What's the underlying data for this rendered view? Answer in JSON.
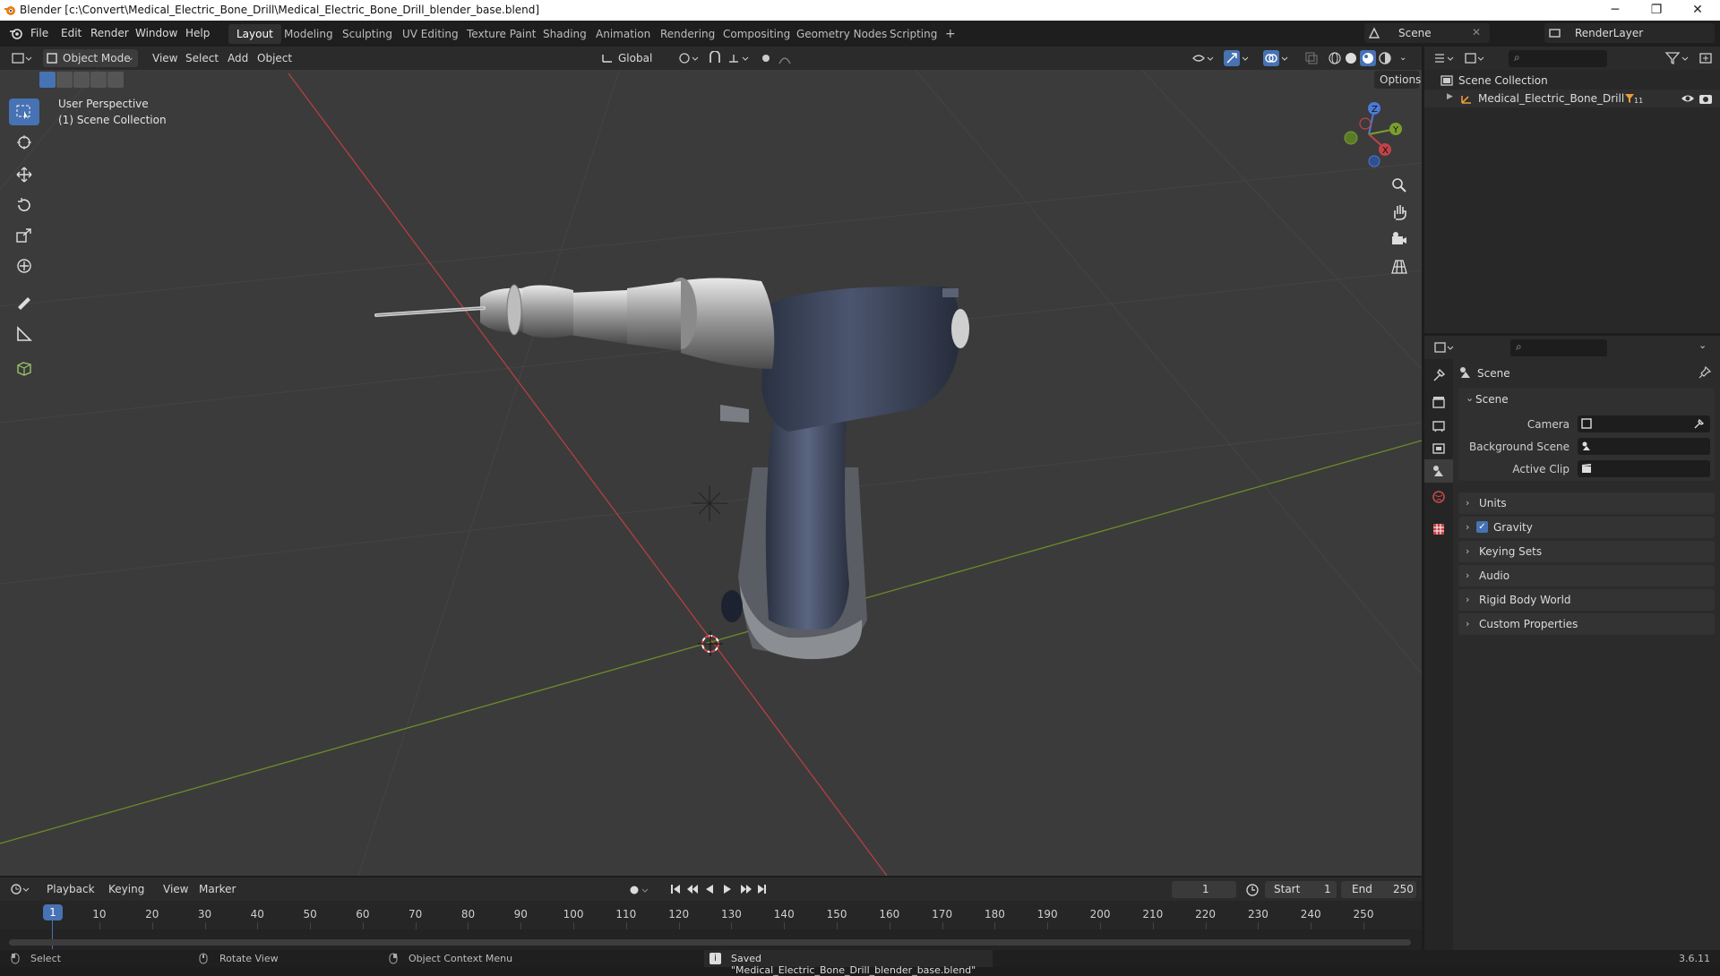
{
  "window": {
    "title": "Blender [c:\\Convert\\Medical_Electric_Bone_Drill\\Medical_Electric_Bone_Drill_blender_base.blend]",
    "minimize": "─",
    "maximize": "❐",
    "close": "✕"
  },
  "menu": [
    "File",
    "Edit",
    "Render",
    "Window",
    "Help"
  ],
  "workspaces": [
    "Layout",
    "Modeling",
    "Sculpting",
    "UV Editing",
    "Texture Paint",
    "Shading",
    "Animation",
    "Rendering",
    "Compositing",
    "Geometry Nodes",
    "Scripting",
    "+"
  ],
  "active_workspace": "Layout",
  "scene_selector": "Scene",
  "renderlayer_selector": "RenderLayer",
  "viewport_header": {
    "mode": "Object Mode",
    "menus": [
      "View",
      "Select",
      "Add",
      "Object"
    ],
    "orientation": "Global",
    "options": "Options"
  },
  "overlay": {
    "perspective": "User Perspective",
    "collection": "(1) Scene Collection"
  },
  "gizmo": {
    "z": "Z",
    "y": "Y",
    "x": "X"
  },
  "outliner": {
    "root": "Scene Collection",
    "object": "Medical_Electric_Bone_Drill",
    "object_badge": "11"
  },
  "properties": {
    "header": "Scene",
    "section": "Scene",
    "fields": [
      {
        "label": "Camera"
      },
      {
        "label": "Background Scene"
      },
      {
        "label": "Active Clip"
      }
    ],
    "panels": [
      "Units",
      "Gravity",
      "Keying Sets",
      "Audio",
      "Rigid Body World",
      "Custom Properties"
    ],
    "gravity_checked": true
  },
  "timeline": {
    "menus": [
      "Playback",
      "Keying",
      "View",
      "Marker"
    ],
    "current_frame": "1",
    "start_label": "Start",
    "start": "1",
    "end_label": "End",
    "end": "250",
    "ruler": [
      "1",
      "10",
      "20",
      "30",
      "40",
      "50",
      "60",
      "70",
      "80",
      "90",
      "100",
      "110",
      "120",
      "130",
      "140",
      "150",
      "160",
      "170",
      "180",
      "190",
      "200",
      "210",
      "220",
      "230",
      "240",
      "250"
    ]
  },
  "statusbar": {
    "select": "Select",
    "rotate": "Rotate View",
    "context": "Object Context Menu",
    "saved": "Saved \"Medical_Electric_Bone_Drill_blender_base.blend\"",
    "version": "3.6.11"
  },
  "colors": {
    "accent": "#4772b3",
    "x_axis": "#c24347",
    "y_axis": "#7aa02c",
    "z_axis": "#4c7ad6",
    "viewport_bg": "#3b3b3b"
  }
}
